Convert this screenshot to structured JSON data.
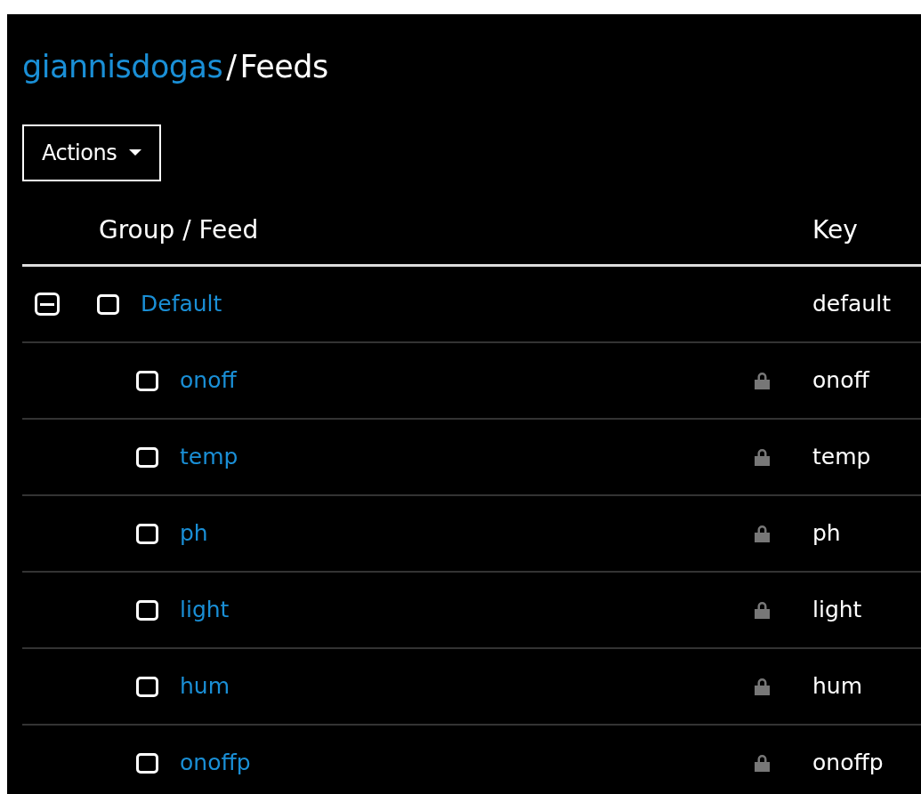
{
  "breadcrumb": {
    "owner": "giannisdogas",
    "separator": "/",
    "page": "Feeds"
  },
  "actions_button": {
    "label": "Actions"
  },
  "table": {
    "columns": [
      "Group / Feed",
      "Key"
    ],
    "groups": [
      {
        "name": "Default",
        "key": "default",
        "expanded": true,
        "checked": false,
        "feeds": [
          {
            "name": "onoff",
            "key": "onoff",
            "checked": false,
            "locked": true
          },
          {
            "name": "temp",
            "key": "temp",
            "checked": false,
            "locked": true
          },
          {
            "name": "ph",
            "key": "ph",
            "checked": false,
            "locked": true
          },
          {
            "name": "light",
            "key": "light",
            "checked": false,
            "locked": true
          },
          {
            "name": "hum",
            "key": "hum",
            "checked": false,
            "locked": true
          },
          {
            "name": "onoffp",
            "key": "onoffp",
            "checked": false,
            "locked": true
          }
        ]
      }
    ]
  }
}
